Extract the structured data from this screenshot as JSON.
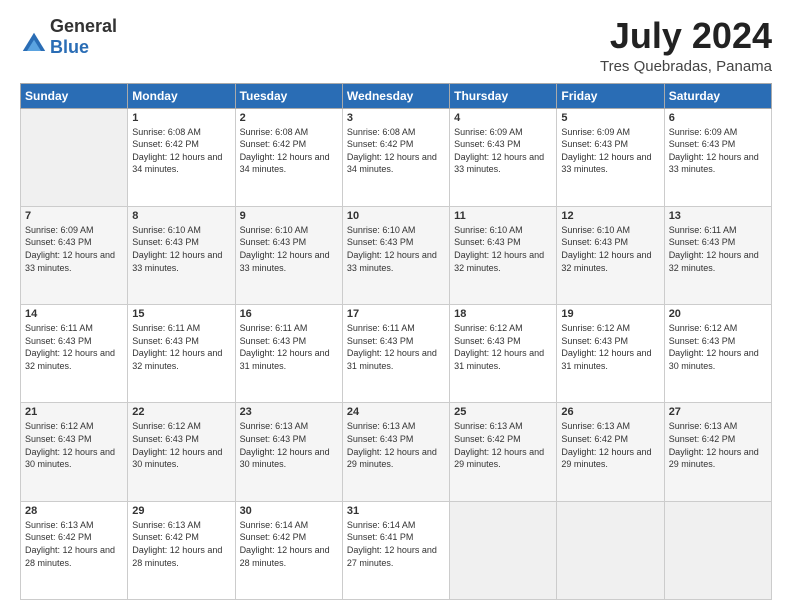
{
  "header": {
    "logo_general": "General",
    "logo_blue": "Blue",
    "month_title": "July 2024",
    "subtitle": "Tres Quebradas, Panama"
  },
  "days_of_week": [
    "Sunday",
    "Monday",
    "Tuesday",
    "Wednesday",
    "Thursday",
    "Friday",
    "Saturday"
  ],
  "weeks": [
    [
      {
        "day": "",
        "sunrise": "",
        "sunset": "",
        "daylight": ""
      },
      {
        "day": "1",
        "sunrise": "Sunrise: 6:08 AM",
        "sunset": "Sunset: 6:42 PM",
        "daylight": "Daylight: 12 hours and 34 minutes."
      },
      {
        "day": "2",
        "sunrise": "Sunrise: 6:08 AM",
        "sunset": "Sunset: 6:42 PM",
        "daylight": "Daylight: 12 hours and 34 minutes."
      },
      {
        "day": "3",
        "sunrise": "Sunrise: 6:08 AM",
        "sunset": "Sunset: 6:42 PM",
        "daylight": "Daylight: 12 hours and 34 minutes."
      },
      {
        "day": "4",
        "sunrise": "Sunrise: 6:09 AM",
        "sunset": "Sunset: 6:43 PM",
        "daylight": "Daylight: 12 hours and 33 minutes."
      },
      {
        "day": "5",
        "sunrise": "Sunrise: 6:09 AM",
        "sunset": "Sunset: 6:43 PM",
        "daylight": "Daylight: 12 hours and 33 minutes."
      },
      {
        "day": "6",
        "sunrise": "Sunrise: 6:09 AM",
        "sunset": "Sunset: 6:43 PM",
        "daylight": "Daylight: 12 hours and 33 minutes."
      }
    ],
    [
      {
        "day": "7",
        "sunrise": "Sunrise: 6:09 AM",
        "sunset": "Sunset: 6:43 PM",
        "daylight": "Daylight: 12 hours and 33 minutes."
      },
      {
        "day": "8",
        "sunrise": "Sunrise: 6:10 AM",
        "sunset": "Sunset: 6:43 PM",
        "daylight": "Daylight: 12 hours and 33 minutes."
      },
      {
        "day": "9",
        "sunrise": "Sunrise: 6:10 AM",
        "sunset": "Sunset: 6:43 PM",
        "daylight": "Daylight: 12 hours and 33 minutes."
      },
      {
        "day": "10",
        "sunrise": "Sunrise: 6:10 AM",
        "sunset": "Sunset: 6:43 PM",
        "daylight": "Daylight: 12 hours and 33 minutes."
      },
      {
        "day": "11",
        "sunrise": "Sunrise: 6:10 AM",
        "sunset": "Sunset: 6:43 PM",
        "daylight": "Daylight: 12 hours and 32 minutes."
      },
      {
        "day": "12",
        "sunrise": "Sunrise: 6:10 AM",
        "sunset": "Sunset: 6:43 PM",
        "daylight": "Daylight: 12 hours and 32 minutes."
      },
      {
        "day": "13",
        "sunrise": "Sunrise: 6:11 AM",
        "sunset": "Sunset: 6:43 PM",
        "daylight": "Daylight: 12 hours and 32 minutes."
      }
    ],
    [
      {
        "day": "14",
        "sunrise": "Sunrise: 6:11 AM",
        "sunset": "Sunset: 6:43 PM",
        "daylight": "Daylight: 12 hours and 32 minutes."
      },
      {
        "day": "15",
        "sunrise": "Sunrise: 6:11 AM",
        "sunset": "Sunset: 6:43 PM",
        "daylight": "Daylight: 12 hours and 32 minutes."
      },
      {
        "day": "16",
        "sunrise": "Sunrise: 6:11 AM",
        "sunset": "Sunset: 6:43 PM",
        "daylight": "Daylight: 12 hours and 31 minutes."
      },
      {
        "day": "17",
        "sunrise": "Sunrise: 6:11 AM",
        "sunset": "Sunset: 6:43 PM",
        "daylight": "Daylight: 12 hours and 31 minutes."
      },
      {
        "day": "18",
        "sunrise": "Sunrise: 6:12 AM",
        "sunset": "Sunset: 6:43 PM",
        "daylight": "Daylight: 12 hours and 31 minutes."
      },
      {
        "day": "19",
        "sunrise": "Sunrise: 6:12 AM",
        "sunset": "Sunset: 6:43 PM",
        "daylight": "Daylight: 12 hours and 31 minutes."
      },
      {
        "day": "20",
        "sunrise": "Sunrise: 6:12 AM",
        "sunset": "Sunset: 6:43 PM",
        "daylight": "Daylight: 12 hours and 30 minutes."
      }
    ],
    [
      {
        "day": "21",
        "sunrise": "Sunrise: 6:12 AM",
        "sunset": "Sunset: 6:43 PM",
        "daylight": "Daylight: 12 hours and 30 minutes."
      },
      {
        "day": "22",
        "sunrise": "Sunrise: 6:12 AM",
        "sunset": "Sunset: 6:43 PM",
        "daylight": "Daylight: 12 hours and 30 minutes."
      },
      {
        "day": "23",
        "sunrise": "Sunrise: 6:13 AM",
        "sunset": "Sunset: 6:43 PM",
        "daylight": "Daylight: 12 hours and 30 minutes."
      },
      {
        "day": "24",
        "sunrise": "Sunrise: 6:13 AM",
        "sunset": "Sunset: 6:43 PM",
        "daylight": "Daylight: 12 hours and 29 minutes."
      },
      {
        "day": "25",
        "sunrise": "Sunrise: 6:13 AM",
        "sunset": "Sunset: 6:42 PM",
        "daylight": "Daylight: 12 hours and 29 minutes."
      },
      {
        "day": "26",
        "sunrise": "Sunrise: 6:13 AM",
        "sunset": "Sunset: 6:42 PM",
        "daylight": "Daylight: 12 hours and 29 minutes."
      },
      {
        "day": "27",
        "sunrise": "Sunrise: 6:13 AM",
        "sunset": "Sunset: 6:42 PM",
        "daylight": "Daylight: 12 hours and 29 minutes."
      }
    ],
    [
      {
        "day": "28",
        "sunrise": "Sunrise: 6:13 AM",
        "sunset": "Sunset: 6:42 PM",
        "daylight": "Daylight: 12 hours and 28 minutes."
      },
      {
        "day": "29",
        "sunrise": "Sunrise: 6:13 AM",
        "sunset": "Sunset: 6:42 PM",
        "daylight": "Daylight: 12 hours and 28 minutes."
      },
      {
        "day": "30",
        "sunrise": "Sunrise: 6:14 AM",
        "sunset": "Sunset: 6:42 PM",
        "daylight": "Daylight: 12 hours and 28 minutes."
      },
      {
        "day": "31",
        "sunrise": "Sunrise: 6:14 AM",
        "sunset": "Sunset: 6:41 PM",
        "daylight": "Daylight: 12 hours and 27 minutes."
      },
      {
        "day": "",
        "sunrise": "",
        "sunset": "",
        "daylight": ""
      },
      {
        "day": "",
        "sunrise": "",
        "sunset": "",
        "daylight": ""
      },
      {
        "day": "",
        "sunrise": "",
        "sunset": "",
        "daylight": ""
      }
    ]
  ]
}
